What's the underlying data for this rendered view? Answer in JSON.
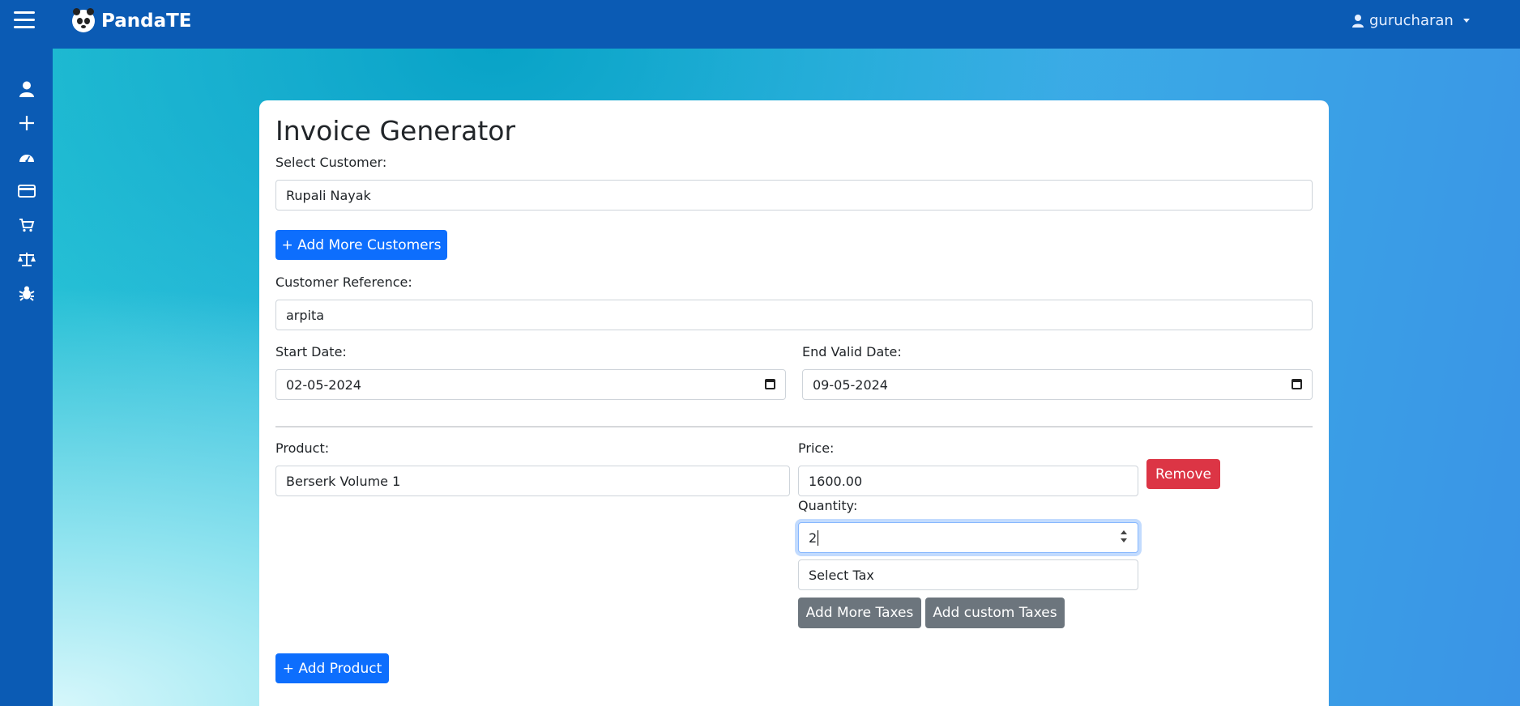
{
  "app": {
    "brand": "PandaTE",
    "user": "gurucharan"
  },
  "sidebar": {
    "items": [
      {
        "icon": "user-icon",
        "label": ""
      },
      {
        "icon": "plus-icon",
        "label": ""
      },
      {
        "icon": "dashboard-icon",
        "label": ""
      },
      {
        "icon": "credit-card-icon",
        "label": ""
      },
      {
        "icon": "cart-icon",
        "label": ""
      },
      {
        "icon": "scale-icon",
        "label": ""
      },
      {
        "icon": "bug-icon",
        "label": ""
      }
    ]
  },
  "form": {
    "title": "Invoice Generator",
    "customer_label": "Select Customer:",
    "customer_value": "Rupali Nayak",
    "add_customers_button": "+ Add More Customers",
    "reference_label": "Customer Reference:",
    "reference_value": "arpita",
    "start_date_label": "Start Date:",
    "start_date_value": "02-05-2024",
    "end_date_label": "End Valid Date:",
    "end_date_value": "09-05-2024",
    "product_label": "Product:",
    "product_value": "Berserk Volume 1",
    "price_label": "Price:",
    "price_value": "1600.00",
    "remove_button": "Remove",
    "quantity_label": "Quantity:",
    "quantity_value": "2",
    "tax_placeholder": "Select Tax",
    "add_taxes_button": "Add More Taxes",
    "custom_taxes_button": "Add custom Taxes",
    "add_product_button": "+ Add Product"
  },
  "colors": {
    "primary": "#0d6efd",
    "danger": "#dc3545",
    "secondary": "#6c757d",
    "nav": "#0b5bb4"
  }
}
